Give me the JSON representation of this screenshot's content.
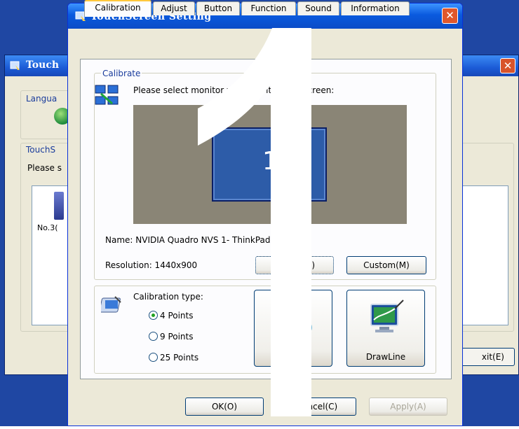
{
  "background_window": {
    "title": "Touch",
    "language_label": "Langua",
    "touchscreen_label": "TouchS",
    "please_text": "Please s",
    "device_label": "No.3(",
    "exit_button": "xit(E)"
  },
  "dialog": {
    "title": "TouchScreen Setting",
    "tabs": [
      "Calibration",
      "Adjust",
      "Button",
      "Function",
      "Sound",
      "Information"
    ],
    "active_tab": "Calibration",
    "calibrate_group": {
      "label": "Calibrate",
      "select_text": "Please select monitor wh      sed with touchscreen:",
      "monitor_number": "1",
      "name_text": "Name:  NVIDIA Quadro NVS 1-       ThinkPad Display",
      "resolution_text": "Resolution: 1440x900",
      "identify_button": "(I)",
      "custom_button": "Custom(M)"
    },
    "calibration_type": {
      "label": "Calibration type:",
      "options": [
        "4 Points",
        "9 Points",
        "25 Points"
      ],
      "selected": "4 Points"
    },
    "calibrate_button": "ate",
    "drawline_button": "DrawLine",
    "footer": {
      "ok": "OK(O)",
      "cancel": "Cancel(C)",
      "apply": "Apply(A)"
    },
    "overlay_digit": "1"
  },
  "colors": {
    "desktop_blue": "#1f47a3",
    "dialog_bg": "#ece9d8",
    "titlebar_blue": "#0a5ade",
    "close_red": "#e0572b",
    "monitor_area": "#8a8576",
    "monitor_blue": "#2d5ca8"
  }
}
